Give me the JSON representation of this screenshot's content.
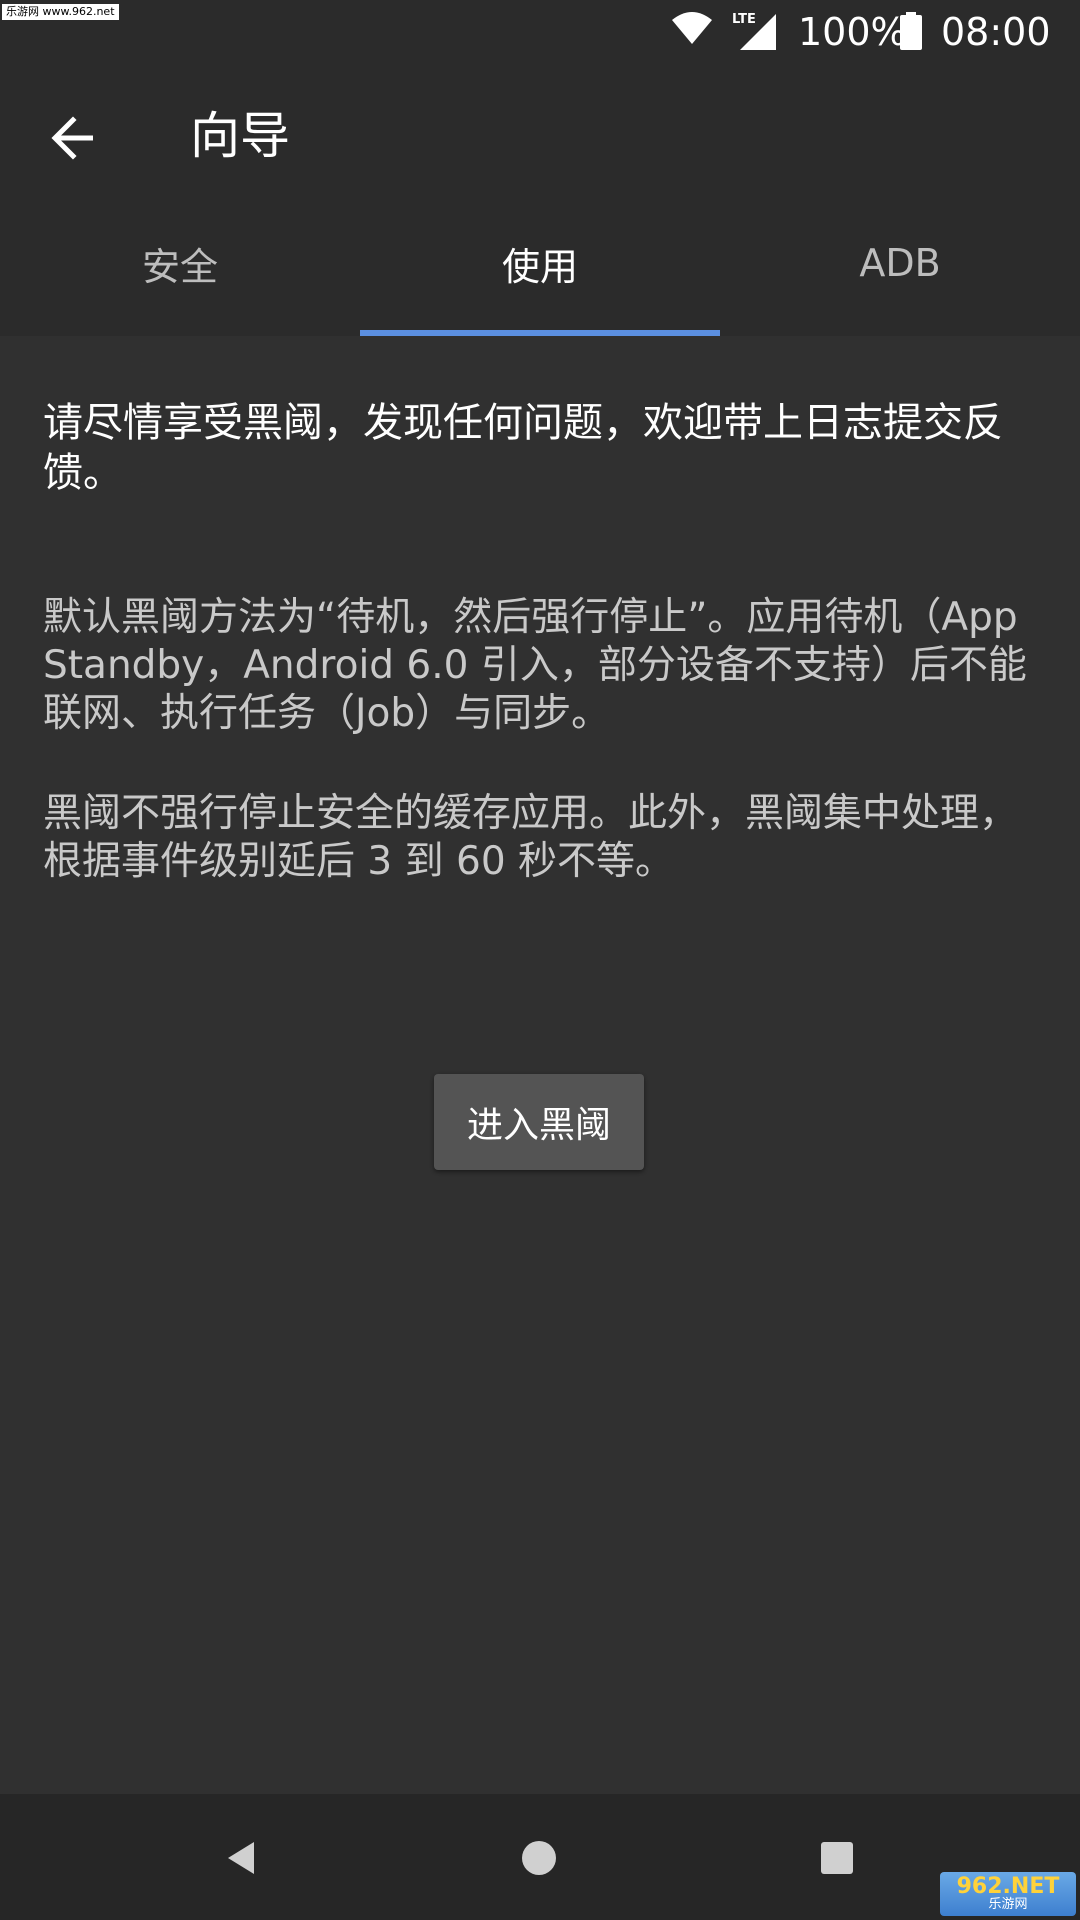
{
  "status_bar": {
    "watermark": "乐游网 www.962.net",
    "network": "LTE",
    "battery_percent": "100%",
    "time": "08:00",
    "icons": [
      "wifi-icon",
      "lte-signal-icon",
      "battery-icon"
    ]
  },
  "app_bar": {
    "title": "向导",
    "back_icon": "arrow-left-icon"
  },
  "tabs": [
    {
      "label": "安全",
      "active": false
    },
    {
      "label": "使用",
      "active": true
    },
    {
      "label": "ADB",
      "active": false
    }
  ],
  "content": {
    "intro": "请尽情享受黑阈，发现任何问题，欢迎带上日志提交反馈。",
    "paragraph_1": "默认黑阈方法为“待机，然后强行停止”。应用待机（App Standby，Android 6.0 引入，部分设备不支持）后不能联网、执行任务（Job）与同步。",
    "paragraph_2": "黑阈不强行停止安全的缓存应用。此外，黑阈集中处理，根据事件级别延后 3 到 60 秒不等。",
    "enter_button": "进入黑阈"
  },
  "nav_bar": {
    "icons": [
      "nav-back-icon",
      "nav-home-icon",
      "nav-recents-icon"
    ]
  },
  "watermark_bottom": {
    "brand": "962.NET",
    "site": "乐游网"
  },
  "colors": {
    "background": "#303030",
    "bar": "#2b2b2b",
    "accent": "#5b8fe0",
    "button": "#545454"
  }
}
